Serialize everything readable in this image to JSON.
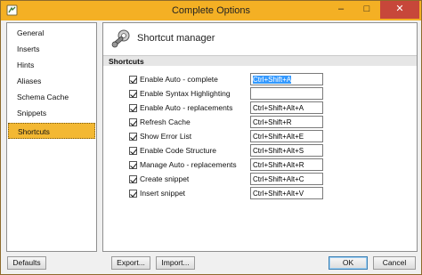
{
  "window": {
    "title": "Complete Options",
    "controls": {
      "minimize": "–",
      "maximize": "□",
      "close": "✕"
    },
    "accent_color": "#f4b024",
    "close_color": "#c7473a"
  },
  "sidebar": {
    "items": [
      {
        "label": "General",
        "selected": false
      },
      {
        "label": "Inserts",
        "selected": false
      },
      {
        "label": "Hints",
        "selected": false
      },
      {
        "label": "Aliases",
        "selected": false
      },
      {
        "label": "Schema Cache",
        "selected": false
      },
      {
        "label": "Snippets",
        "selected": false
      },
      {
        "label": "Shortcuts",
        "selected": true
      }
    ],
    "selected_color": "#f3b833"
  },
  "main": {
    "header_title": "Shortcut manager",
    "header_icon": "wrench-gear-icon",
    "section_title": "Shortcuts",
    "rows": [
      {
        "label": "Enable Auto - complete",
        "checked": true,
        "shortcut": "Ctrl+Shift+A",
        "selected": true
      },
      {
        "label": "Enable Syntax Highlighting",
        "checked": true,
        "shortcut": "",
        "selected": false
      },
      {
        "label": "Enable Auto - replacements",
        "checked": true,
        "shortcut": "Ctrl+Shift+Alt+A",
        "selected": false
      },
      {
        "label": "Refresh Cache",
        "checked": true,
        "shortcut": "Ctrl+Shift+R",
        "selected": false
      },
      {
        "label": "Show Error List",
        "checked": true,
        "shortcut": "Ctrl+Shift+Alt+E",
        "selected": false
      },
      {
        "label": "Enable Code Structure",
        "checked": true,
        "shortcut": "Ctrl+Shift+Alt+S",
        "selected": false
      },
      {
        "label": "Manage Auto - replacements",
        "checked": true,
        "shortcut": "Ctrl+Shift+Alt+R",
        "selected": false
      },
      {
        "label": "Create snippet",
        "checked": true,
        "shortcut": "Ctrl+Shift+Alt+C",
        "selected": false
      },
      {
        "label": "Insert snippet",
        "checked": true,
        "shortcut": "Ctrl+Shift+Alt+V",
        "selected": false
      }
    ]
  },
  "footer": {
    "defaults_label": "Defaults",
    "export_label": "Export...",
    "import_label": "Import...",
    "ok_label": "OK",
    "cancel_label": "Cancel"
  }
}
